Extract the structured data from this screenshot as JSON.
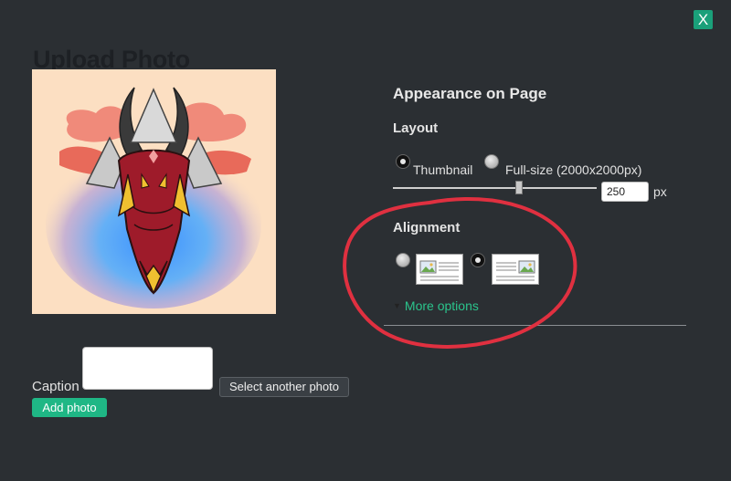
{
  "dialog": {
    "close_label": "X",
    "title": "Upload Photo"
  },
  "form": {
    "caption_label": "Caption",
    "caption_value": "",
    "select_another_label": "Select another photo",
    "add_photo_label": "Add photo"
  },
  "appearance": {
    "heading": "Appearance on Page",
    "layout_heading": "Layout",
    "layout_options": [
      {
        "label": "Thumbnail",
        "selected": true
      },
      {
        "label": "Full-size (2000x2000px)",
        "selected": false
      }
    ],
    "size_value": "250",
    "size_unit": "px",
    "slider_level_fraction": 0.61,
    "alignment_heading": "Alignment",
    "alignment_options": [
      {
        "name": "image-left",
        "selected": false
      },
      {
        "name": "image-right",
        "selected": true
      }
    ],
    "more_options_label": "More options"
  },
  "colors": {
    "accent": "#1fb785",
    "link": "#2bc48c",
    "background": "#2b2f33",
    "annotation": "#e03040"
  }
}
